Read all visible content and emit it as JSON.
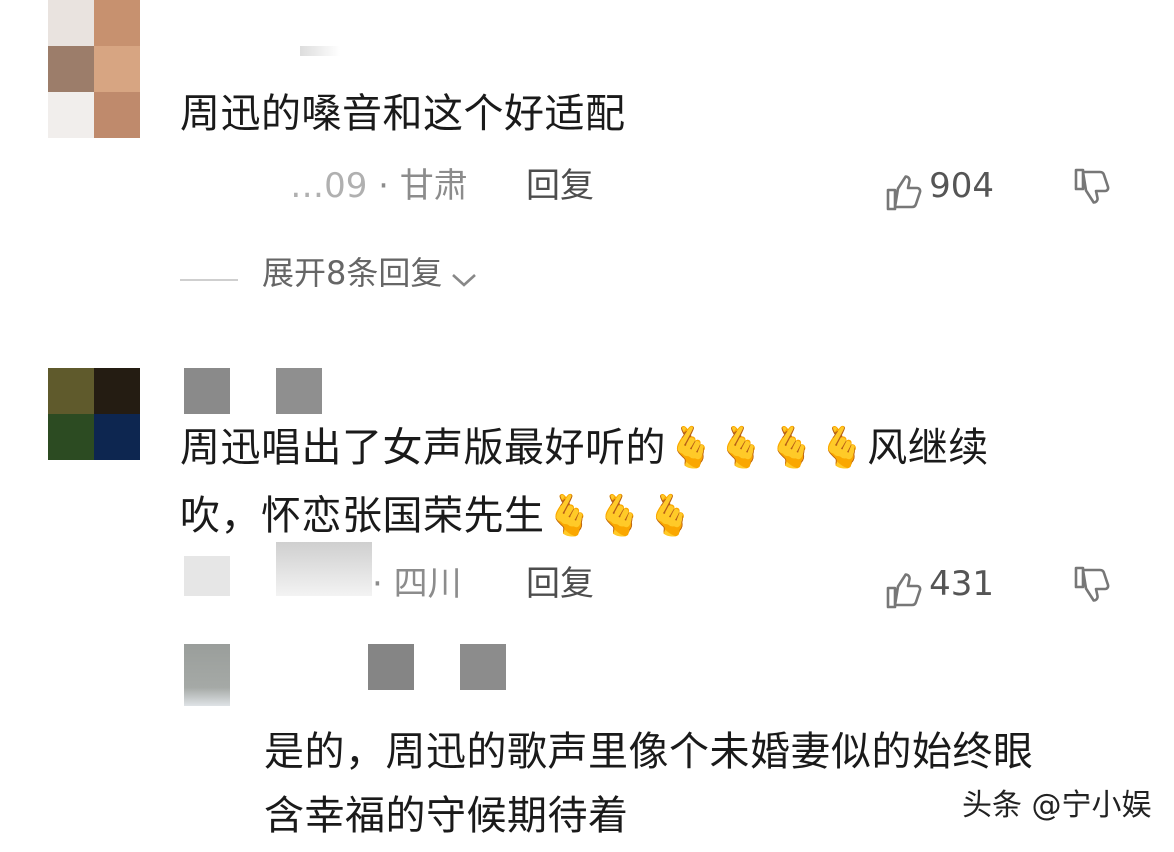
{
  "comments": [
    {
      "text": "周迅的嗓音和这个好适配",
      "meta_time": "…09",
      "meta_location": "甘肃",
      "reply_label": "回复",
      "likes": "904",
      "expand_label": "展开8条回复"
    },
    {
      "text_line1": "周迅唱出了女声版最好听的",
      "text_line1_tail": "风继续",
      "text_line2": "吹，怀恋张国荣先生",
      "emoji": "🫰",
      "meta_location": "四川",
      "reply_label": "回复",
      "likes": "431",
      "reply": {
        "text_line1": "是的，周迅的歌声里像个未婚妻似的始终眼",
        "text_line2": "含幸福的守候期待着"
      }
    }
  ],
  "watermark": "头条 @宁小娱",
  "icons": {
    "like": "thumbs-up-icon",
    "dislike": "thumbs-down-icon",
    "expand": "chevron-down-icon"
  }
}
